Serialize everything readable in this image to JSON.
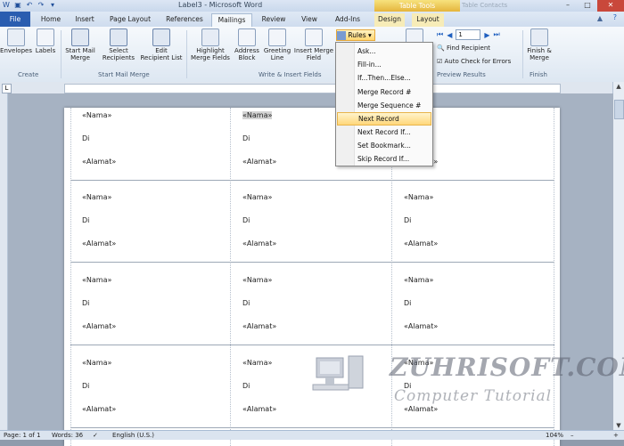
{
  "titlebar": {
    "title": "Label3 - Microsoft Word",
    "table_tools": "Table Tools",
    "ghost_tab": "Table Contacts"
  },
  "tabs": [
    "File",
    "Home",
    "Insert",
    "Page Layout",
    "References",
    "Mailings",
    "Review",
    "View",
    "Add-Ins",
    "Design",
    "Layout"
  ],
  "ribbon": {
    "create": {
      "envelopes": "Envelopes",
      "labels": "Labels",
      "group": "Create"
    },
    "start": {
      "start_mail_merge": "Start Mail Merge",
      "select_recipients": "Select Recipients",
      "edit_recipient_list": "Edit Recipient List",
      "group": "Start Mail Merge"
    },
    "write": {
      "highlight": "Highlight Merge Fields",
      "address_block": "Address Block",
      "greeting_line": "Greeting Line",
      "insert_field": "Insert Merge Field",
      "rules": "Rules",
      "group": "Write & Insert Fields"
    },
    "preview": {
      "record": "1",
      "find_recipient": "Find Recipient",
      "auto_check": "Auto Check for Errors",
      "group": "Preview Results"
    },
    "finish": {
      "finish_merge": "Finish & Merge",
      "group": "Finish"
    }
  },
  "rules_menu": [
    {
      "label": "Ask...",
      "selected": false
    },
    {
      "label": "Fill-in...",
      "selected": false
    },
    {
      "label": "If...Then...Else...",
      "selected": false
    },
    {
      "label": "Merge Record #",
      "selected": false
    },
    {
      "label": "Merge Sequence #",
      "selected": false
    },
    {
      "label": "Next Record",
      "selected": true
    },
    {
      "label": "Next Record If...",
      "selected": false
    },
    {
      "label": "Set Bookmark...",
      "selected": false
    },
    {
      "label": "Skip Record If...",
      "selected": false
    }
  ],
  "labels": {
    "nama": "«Nama»",
    "di": "Di",
    "alamat": "«Alamat»"
  },
  "watermark": {
    "brand": "ZUHRISOFT.COM",
    "sub": "Computer Tutorial"
  },
  "statusbar": {
    "page": "Page: 1 of 1",
    "words": "Words: 36",
    "language": "English (U.S.)",
    "zoom": "104%"
  },
  "colors": {
    "file_tab": "#2a5db0",
    "menu_highlight": "#ffd77a",
    "table_tools": "#e5b53c"
  }
}
